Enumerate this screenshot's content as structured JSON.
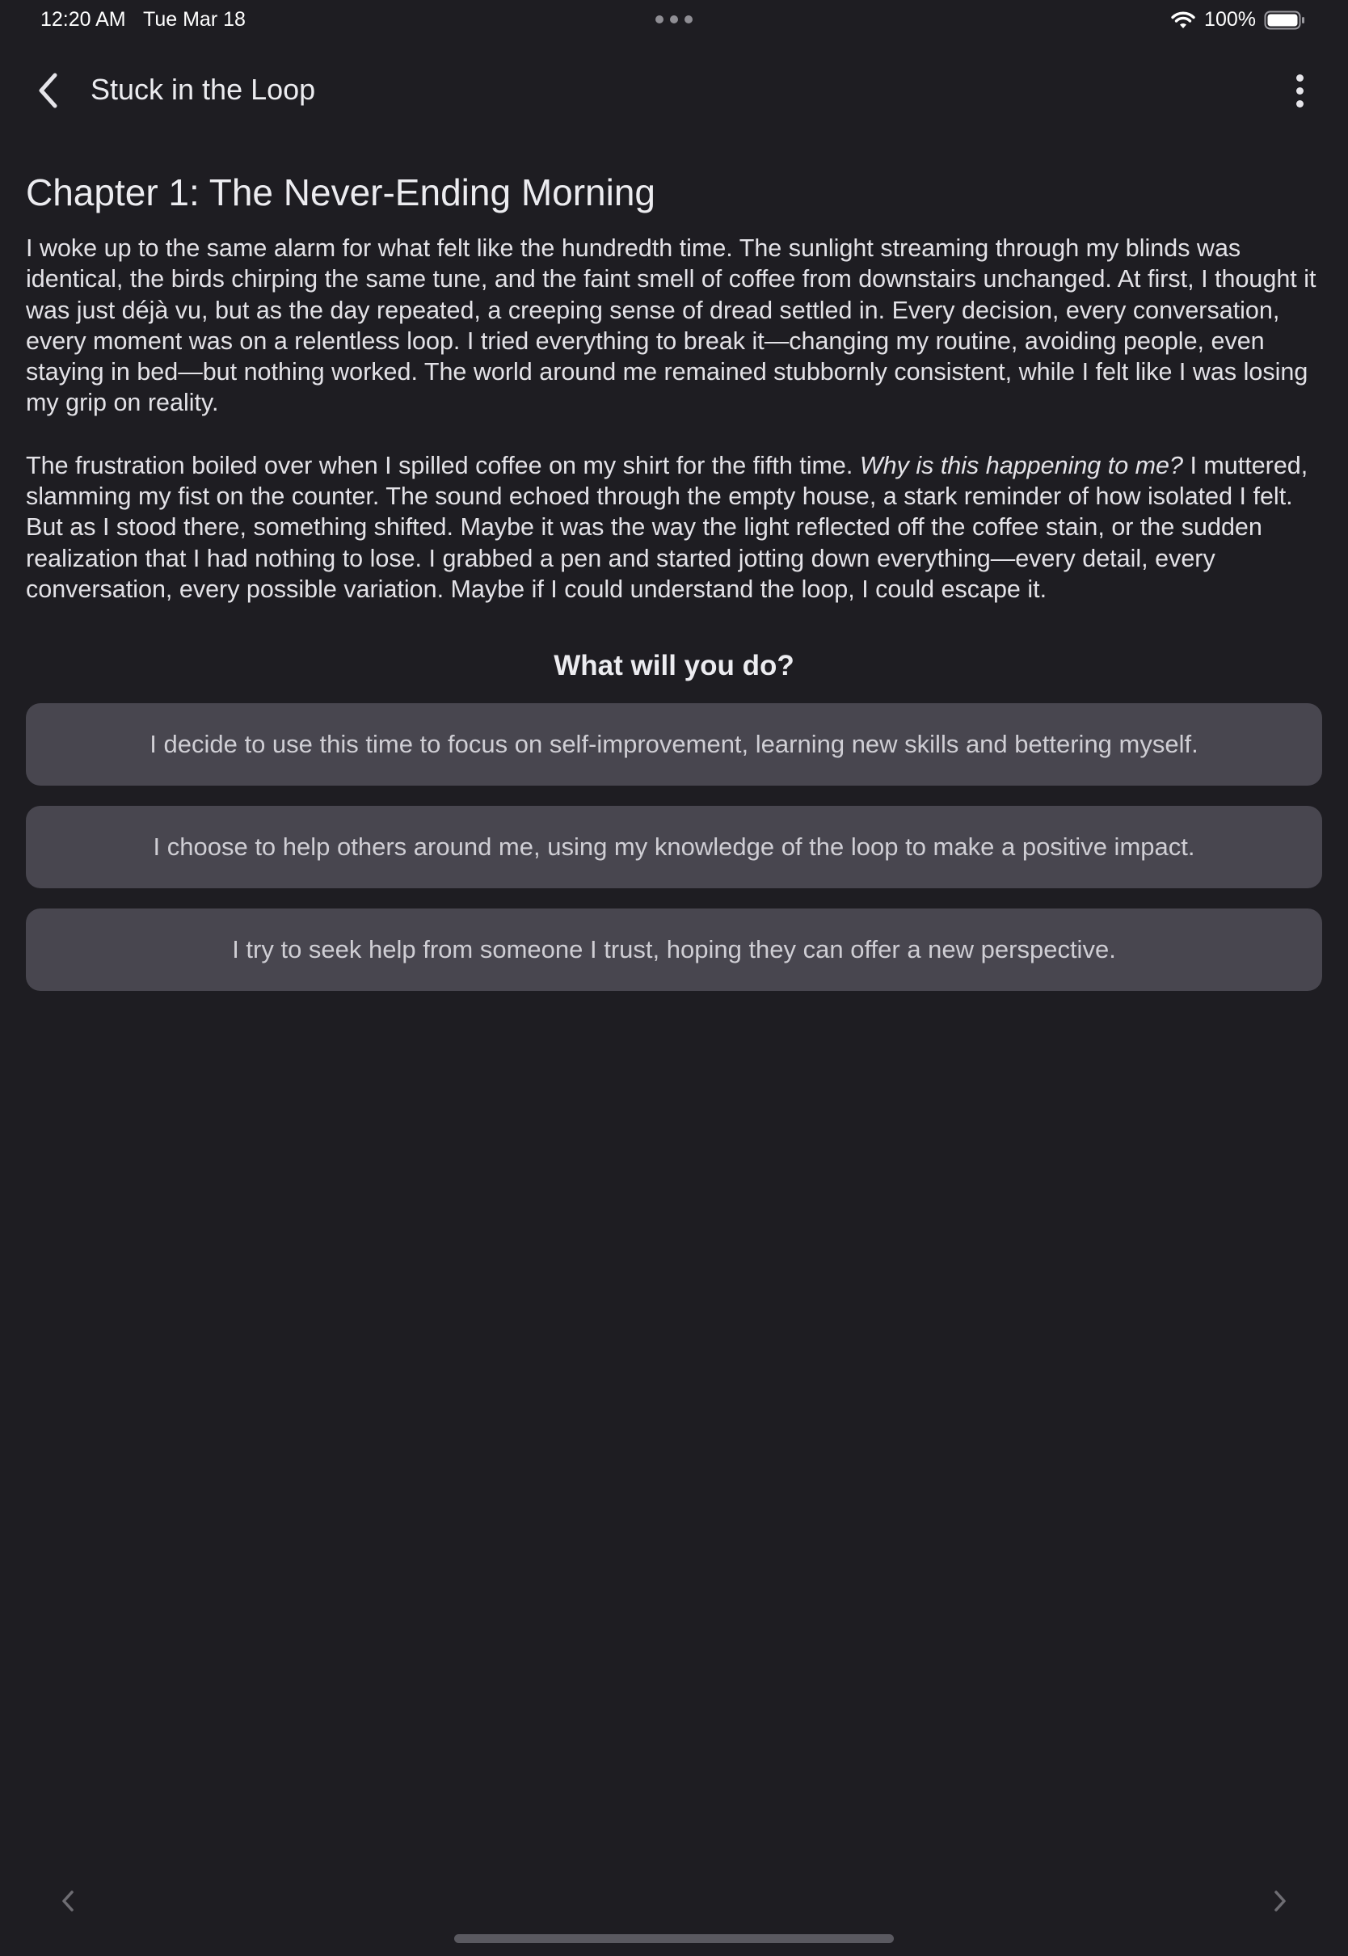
{
  "status_bar": {
    "time": "12:20 AM",
    "date": "Tue Mar 18",
    "battery": "100%",
    "icons": [
      "wifi-icon",
      "battery-icon",
      "multitasking-dots-icon"
    ]
  },
  "nav": {
    "title": "Stuck in the Loop",
    "back_icon": "chevron-left-icon",
    "more_icon": "more-vertical-icon"
  },
  "story": {
    "chapter_title": "Chapter 1: The Never-Ending Morning",
    "paragraph_1": "I woke up to the same alarm for what felt like the hundredth time. The sunlight streaming through my blinds was identical, the birds chirping the same tune, and the faint smell of coffee from downstairs unchanged. At first, I thought it was just déjà vu, but as the day repeated, a creeping sense of dread settled in. Every decision, every conversation, every moment was on a relentless loop. I tried everything to break it—changing my routine, avoiding people, even staying in bed—but nothing worked. The world around me remained stubbornly consistent, while I felt like I was losing my grip on reality.",
    "paragraph_2_before": "The frustration boiled over when I spilled coffee on my shirt for the fifth time. ",
    "paragraph_2_italic": "Why is this happening to me?",
    "paragraph_2_after": " I muttered, slamming my fist on the counter. The sound echoed through the empty house, a stark reminder of how isolated I felt. But as I stood there, something shifted. Maybe it was the way the light reflected off the coffee stain, or the sudden realization that I had nothing to lose. I grabbed a pen and started jotting down everything—every detail, every conversation, every possible variation. Maybe if I could understand the loop, I could escape it."
  },
  "prompt": "What will you do?",
  "choices": [
    "I decide to use this time to focus on self-improvement, learning new skills and bettering myself.",
    "I choose to help others around me, using my knowledge of the loop to make a positive impact.",
    "I try to seek help from someone I trust, hoping they can offer a new perspective."
  ],
  "pager": {
    "prev_icon": "chevron-left-icon",
    "next_icon": "chevron-right-icon"
  },
  "colors": {
    "background": "#1e1d22",
    "choice_background": "#48464f",
    "text": "#e6e5ea",
    "pager_arrow": "#6e6d73"
  }
}
